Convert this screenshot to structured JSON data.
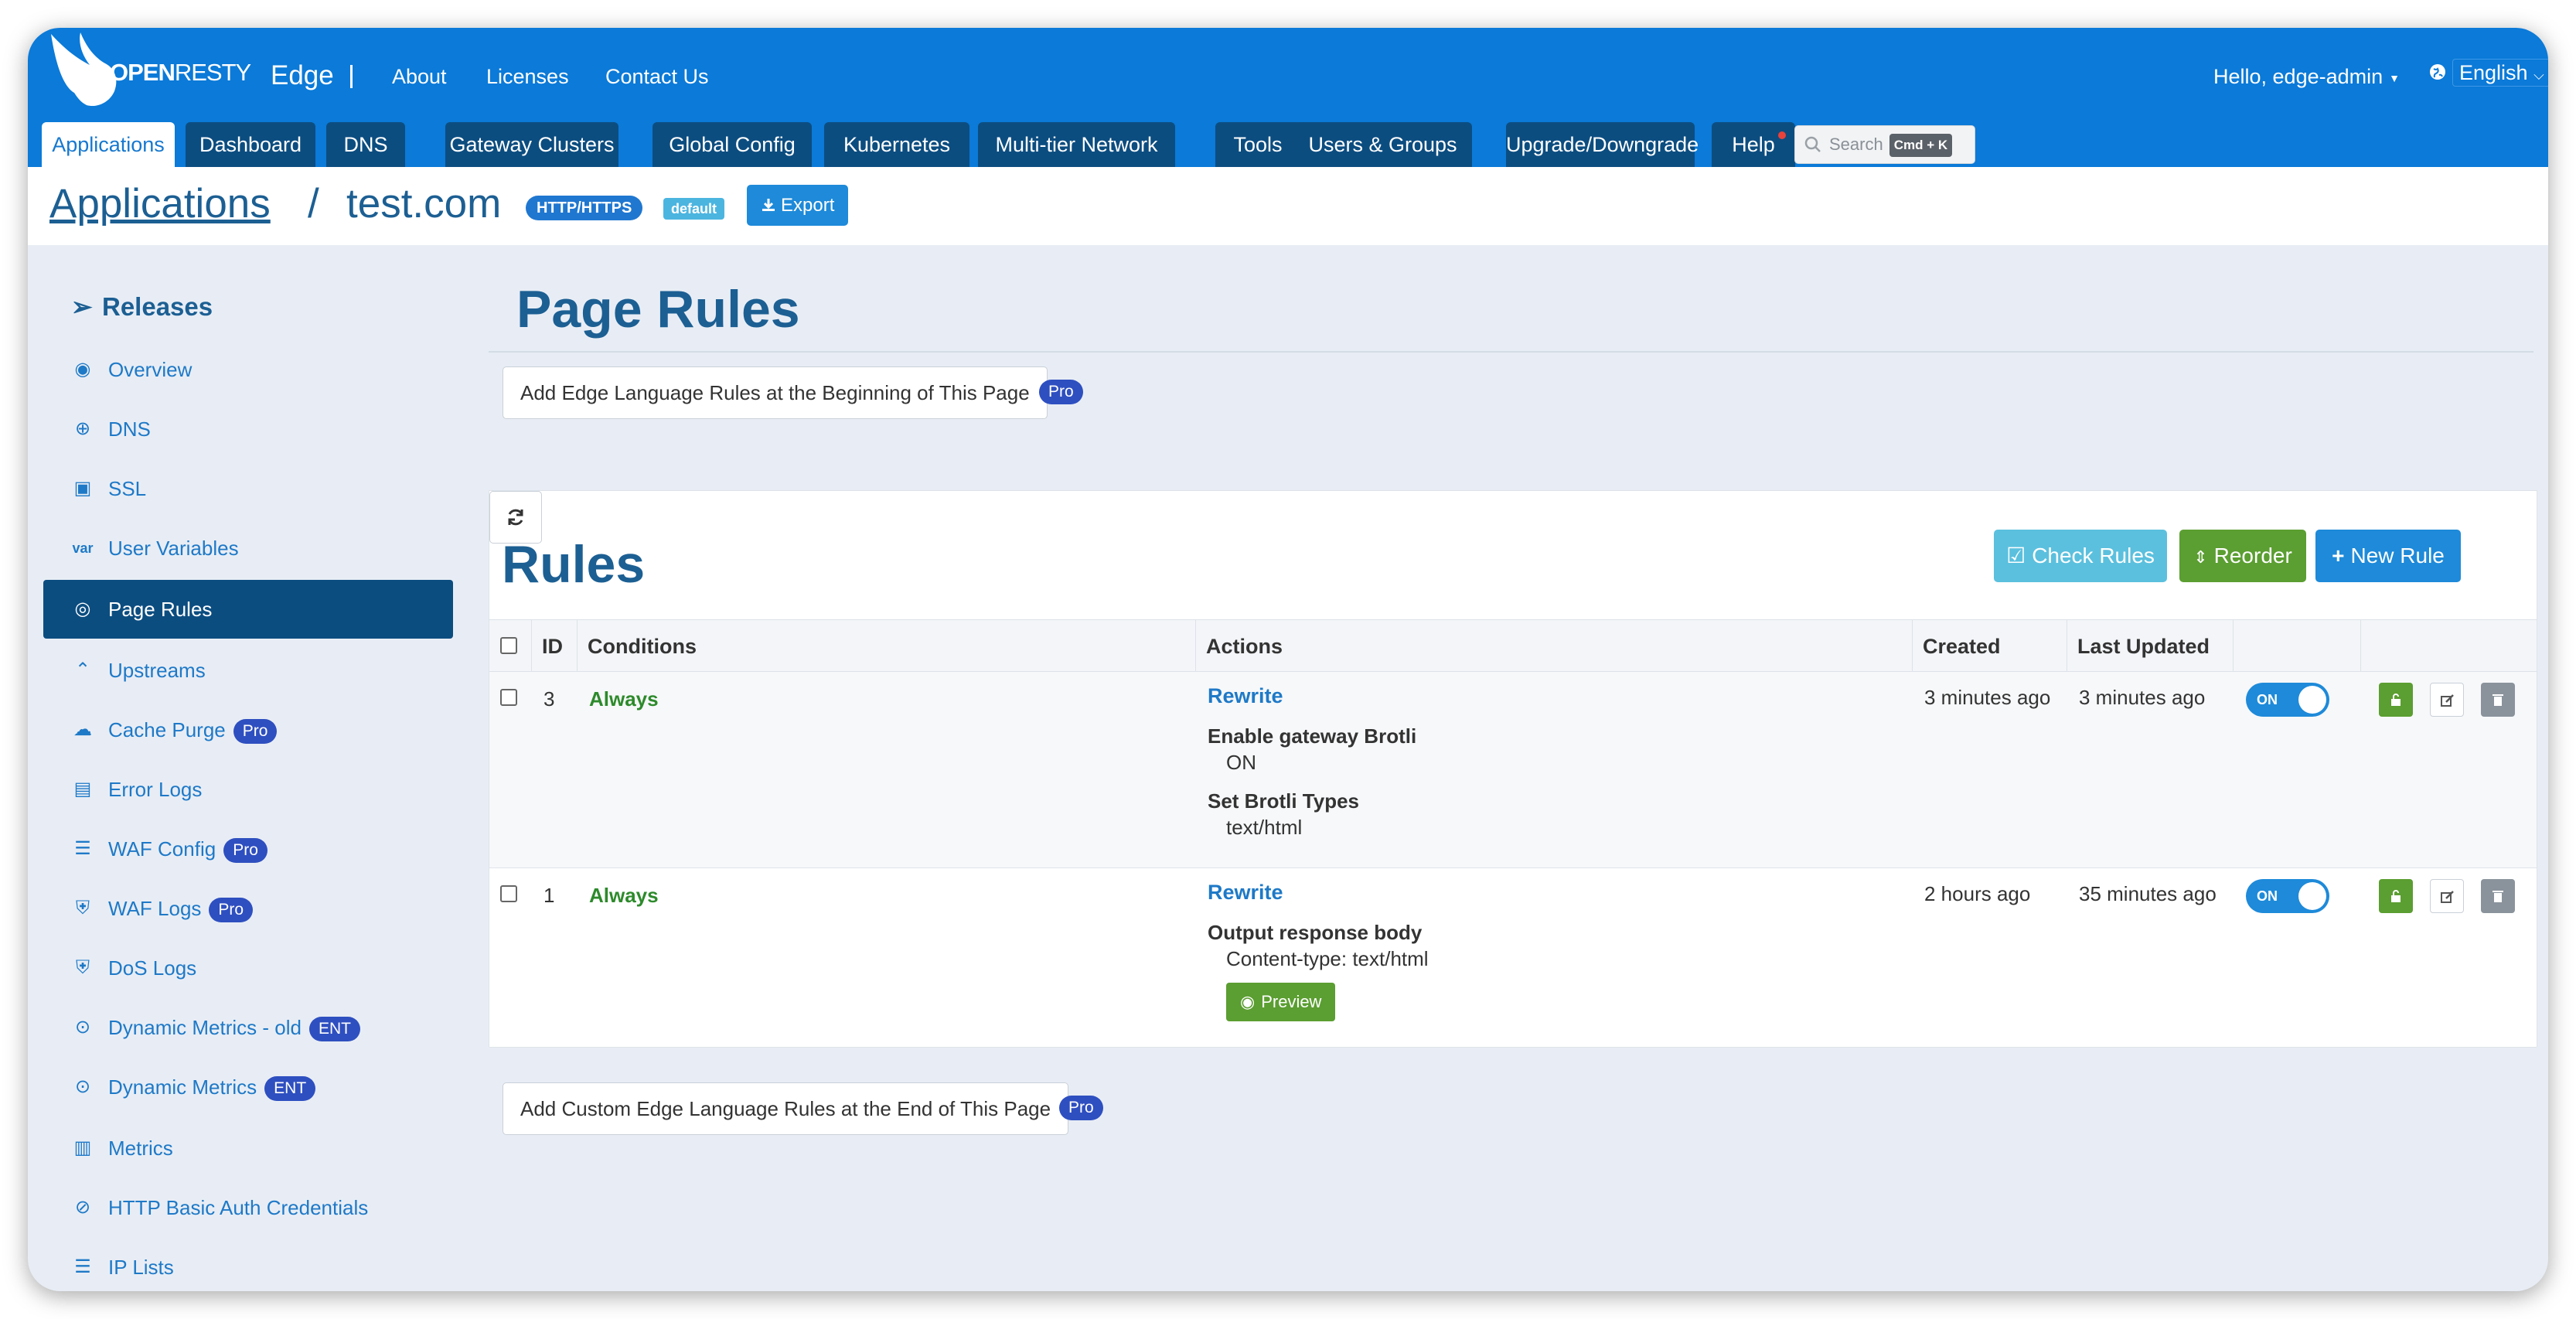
{
  "app": {
    "brand": {
      "bold": "OPEN",
      "thin": "RESTY",
      "product": "Edge"
    },
    "top_links": [
      "About",
      "Licenses",
      "Contact Us"
    ],
    "user_greeting": "Hello, edge-admin",
    "language": "English"
  },
  "tabs": [
    {
      "label": "Applications",
      "active": true
    },
    {
      "label": "Dashboard"
    },
    {
      "label": "DNS"
    },
    {
      "label": "Gateway Clusters"
    },
    {
      "label": "Global Config"
    },
    {
      "label": "Kubernetes"
    },
    {
      "label": "Multi-tier Network"
    },
    {
      "label": "Tools"
    },
    {
      "label": "Users & Groups"
    },
    {
      "label": "Upgrade/Downgrade"
    },
    {
      "label": "Help"
    }
  ],
  "search": {
    "placeholder": "Search",
    "shortcut": "Cmd + K"
  },
  "breadcrumb": {
    "root": "Applications",
    "separator": "/",
    "app": "test.com",
    "protocol_badge": "HTTP/HTTPS",
    "partition_badge": "default",
    "export_label": "Export"
  },
  "sidebar": {
    "heading": "Releases",
    "items": [
      {
        "label": "Overview",
        "icon": "dashboard-icon"
      },
      {
        "label": "DNS",
        "icon": "globe-icon"
      },
      {
        "label": "SSL",
        "icon": "certificate-icon"
      },
      {
        "label": "User Variables",
        "icon": "var-icon"
      },
      {
        "label": "Page Rules",
        "icon": "rules-icon",
        "active": true
      },
      {
        "label": "Upstreams",
        "icon": "upstream-icon"
      },
      {
        "label": "Cache Purge",
        "icon": "cloud-icon",
        "badge": "Pro"
      },
      {
        "label": "Error Logs",
        "icon": "log-icon"
      },
      {
        "label": "WAF Config",
        "icon": "list-icon",
        "badge": "Pro"
      },
      {
        "label": "WAF Logs",
        "icon": "shield-log-icon",
        "badge": "Pro"
      },
      {
        "label": "DoS Logs",
        "icon": "shield-log-icon"
      },
      {
        "label": "Dynamic Metrics - old",
        "icon": "pin-icon",
        "badge": "ENT"
      },
      {
        "label": "Dynamic Metrics",
        "icon": "pin-icon",
        "badge": "ENT"
      },
      {
        "label": "Metrics",
        "icon": "bar-chart-icon"
      },
      {
        "label": "HTTP Basic Auth Credentials",
        "icon": "auth-icon"
      },
      {
        "label": "IP Lists",
        "icon": "list-icon"
      }
    ]
  },
  "main": {
    "title": "Page Rules",
    "add_begin_label": "Add Edge Language Rules at the Beginning of This Page",
    "add_end_label": "Add Custom Edge Language Rules at the End of This Page",
    "pro_badge": "Pro",
    "rules": {
      "title": "Rules",
      "check_label": "Check Rules",
      "reorder_label": "Reorder",
      "new_label": "New Rule",
      "columns": [
        "ID",
        "Conditions",
        "Actions",
        "Created",
        "Last Updated"
      ],
      "rows": [
        {
          "id": "3",
          "condition": "Always",
          "action_title": "Rewrite",
          "actions": [
            {
              "name": "Enable gateway Brotli",
              "value": "ON"
            },
            {
              "name": "Set Brotli Types",
              "value": "text/html"
            }
          ],
          "created": "3 minutes ago",
          "updated": "3 minutes ago",
          "status": "ON"
        },
        {
          "id": "1",
          "condition": "Always",
          "action_title": "Rewrite",
          "actions": [
            {
              "name": "Output response body",
              "value": "Content-type: text/html"
            }
          ],
          "preview_label": "Preview",
          "created": "2 hours ago",
          "updated": "35 minutes ago",
          "status": "ON"
        }
      ]
    }
  },
  "colors": {
    "topbar": "#0b7ad8",
    "tab": "#0c4d80",
    "heading": "#1c5f93",
    "link": "#1e79c7",
    "green": "#5b9e31",
    "info": "#5bc0de",
    "pro_badge": "#2e4fc0"
  }
}
